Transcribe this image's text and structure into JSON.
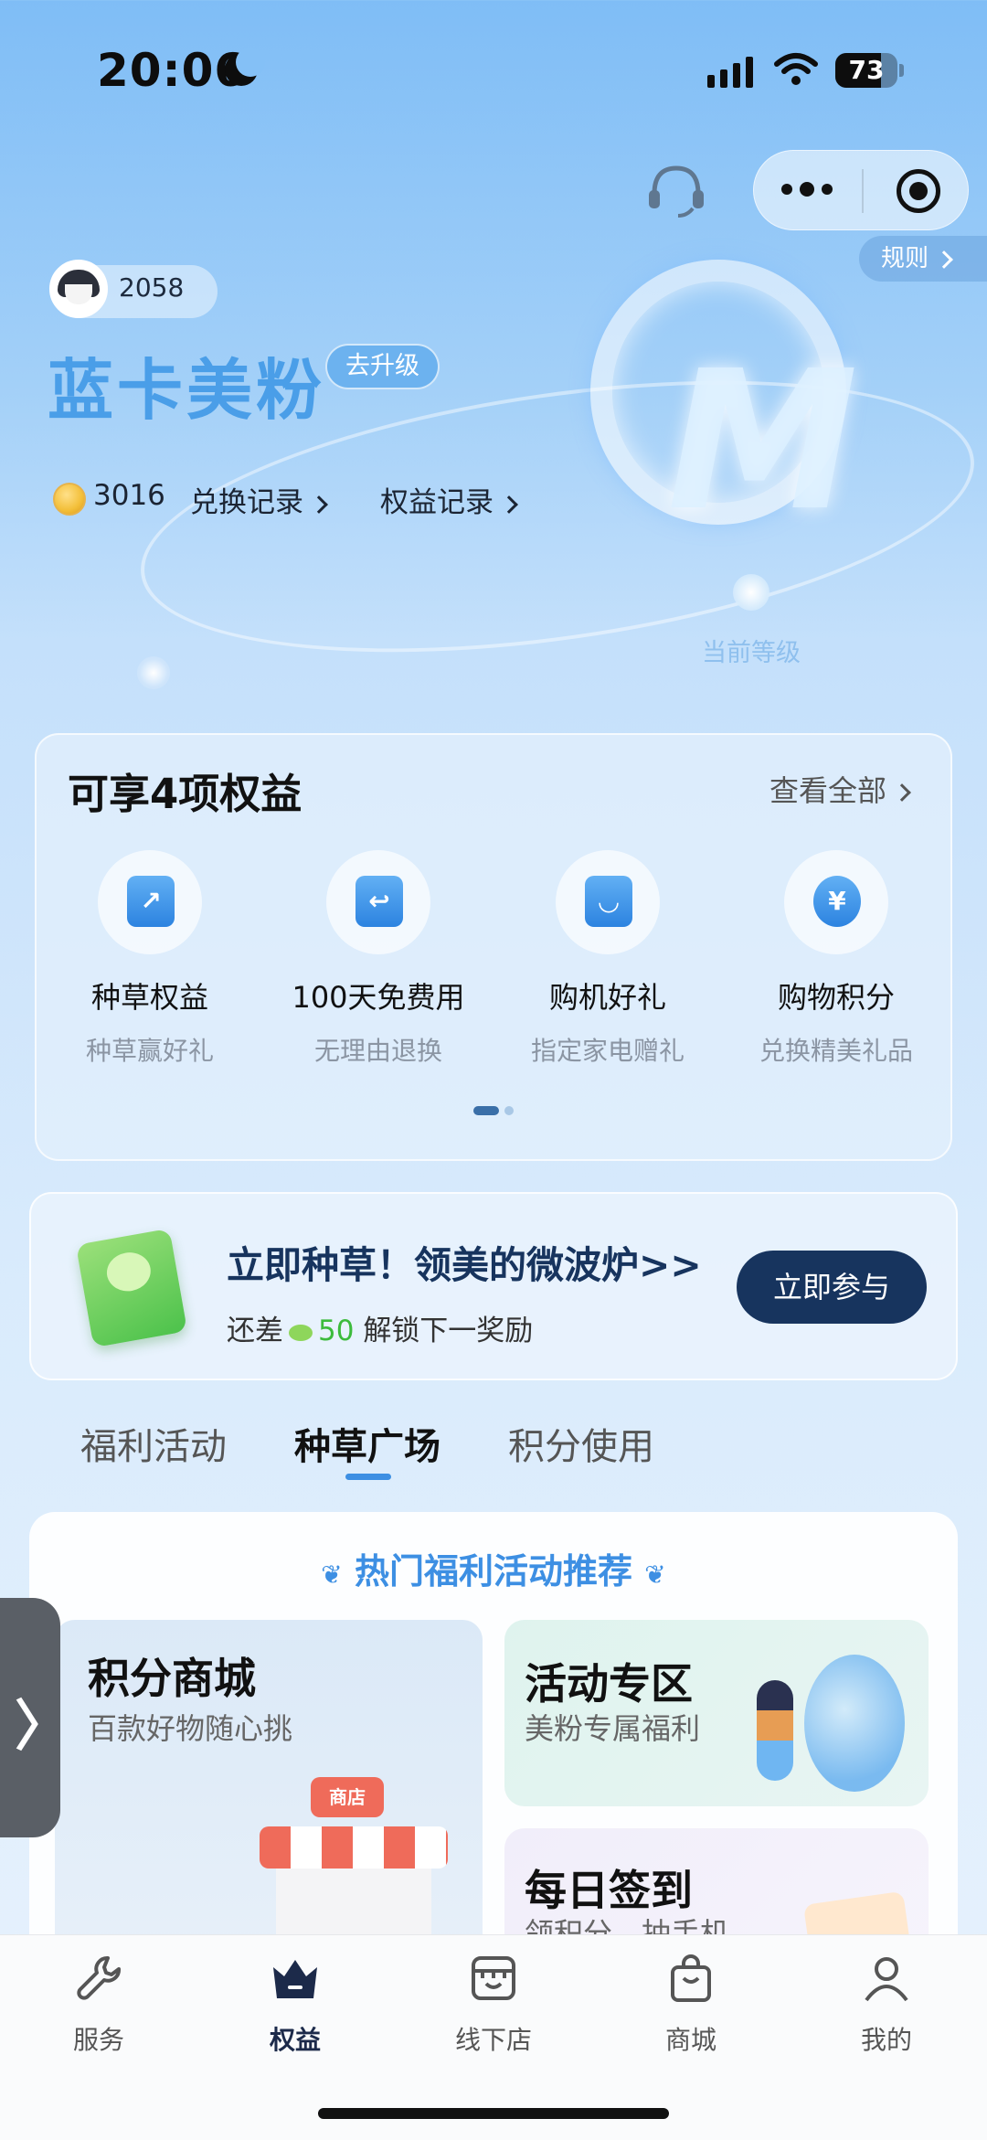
{
  "status_bar": {
    "time": "20:06",
    "battery": "73",
    "battery_level": 0.73
  },
  "header": {
    "rules_label": "规则"
  },
  "user": {
    "id": "2058",
    "tier": "蓝卡美粉",
    "upgrade_label": "去升级",
    "points": "3016",
    "exchange_link": "兑换记录",
    "benefit_link": "权益记录",
    "current_level_label": "当前等级"
  },
  "benefits": {
    "title": "可享4项权益",
    "view_all": "查看全部",
    "items": [
      {
        "name": "种草权益",
        "desc": "种草赢好礼",
        "icon": "flag-chart-icon"
      },
      {
        "name": "100天免费用",
        "desc": "无理由退换",
        "icon": "return-box-icon"
      },
      {
        "name": "购机好礼",
        "desc": "指定家电赠礼",
        "icon": "shopping-bag-icon"
      },
      {
        "name": "购物积分",
        "desc": "兑换精美礼品",
        "icon": "yen-badge-icon"
      }
    ]
  },
  "promo": {
    "title": "立即种草！领美的微波炉>>",
    "sub_prefix": "还差",
    "sub_value": "50",
    "sub_suffix": "解锁下一奖励",
    "button": "立即参与"
  },
  "tabs": [
    "福利活动",
    "种草广场",
    "积分使用"
  ],
  "active_tab": 1,
  "hot": {
    "title": "热门福利活动推荐",
    "store_sign": "商店",
    "tiles": [
      {
        "title": "积分商城",
        "sub": "百款好物随心挑"
      },
      {
        "title": "活动专区",
        "sub": "美粉专属福利"
      },
      {
        "title": "每日签到",
        "sub": "领积分，抽手机"
      }
    ]
  },
  "bottom_nav": [
    {
      "label": "服务",
      "icon": "wrench-icon"
    },
    {
      "label": "权益",
      "icon": "crown-icon"
    },
    {
      "label": "线下店",
      "icon": "store-icon"
    },
    {
      "label": "商城",
      "icon": "bag-icon"
    },
    {
      "label": "我的",
      "icon": "person-icon"
    }
  ],
  "colors": {
    "accent": "#3d8fe3",
    "dark_navy": "#17345e",
    "tier_blue": "#4a9ee8",
    "green": "#3cbb3c"
  }
}
